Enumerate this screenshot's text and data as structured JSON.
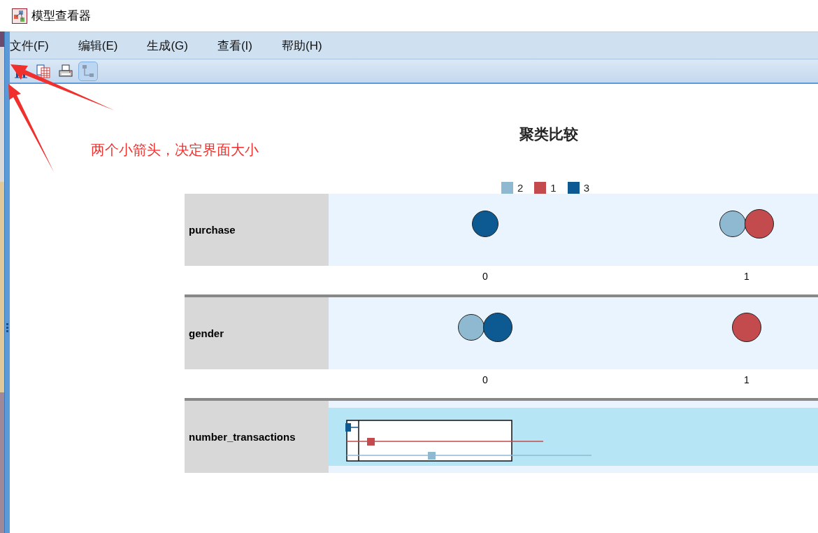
{
  "window": {
    "title": "模型查看器"
  },
  "menu": [
    {
      "label": "文件(F)"
    },
    {
      "label": "编辑(E)"
    },
    {
      "label": "生成(G)"
    },
    {
      "label": "查看(I)"
    },
    {
      "label": "帮助(H)"
    }
  ],
  "toolbar": [
    {
      "kind": "chart",
      "selected": false
    },
    {
      "kind": "table",
      "selected": false
    },
    {
      "kind": "print",
      "selected": false
    },
    {
      "kind": "tree",
      "selected": true
    }
  ],
  "chart": {
    "title": "聚类比较",
    "legend": [
      {
        "label": "2",
        "color": "#8fb9d1"
      },
      {
        "label": "1",
        "color": "#c34a4d"
      },
      {
        "label": "3",
        "color": "#0d5a93"
      }
    ],
    "rows": [
      {
        "kind": "categorical",
        "label": "purchase",
        "categories": [
          {
            "label": "0",
            "clusters": [
              {
                "color": "#0d5a93"
              }
            ]
          },
          {
            "label": "1",
            "clusters": [
              {
                "color": "#8fb9d1"
              },
              {
                "color": "#c34a4d"
              }
            ]
          }
        ]
      },
      {
        "kind": "categorical",
        "label": "gender",
        "categories": [
          {
            "label": "0",
            "clusters": [
              {
                "color": "#8fb9d1"
              },
              {
                "color": "#0d5a93"
              }
            ]
          },
          {
            "label": "1",
            "clusters": [
              {
                "color": "#c34a4d"
              }
            ]
          }
        ]
      },
      {
        "kind": "boxplot",
        "label": "number_transactions"
      }
    ]
  },
  "annotation": {
    "text": "两个小箭头，决定界面大小"
  }
}
